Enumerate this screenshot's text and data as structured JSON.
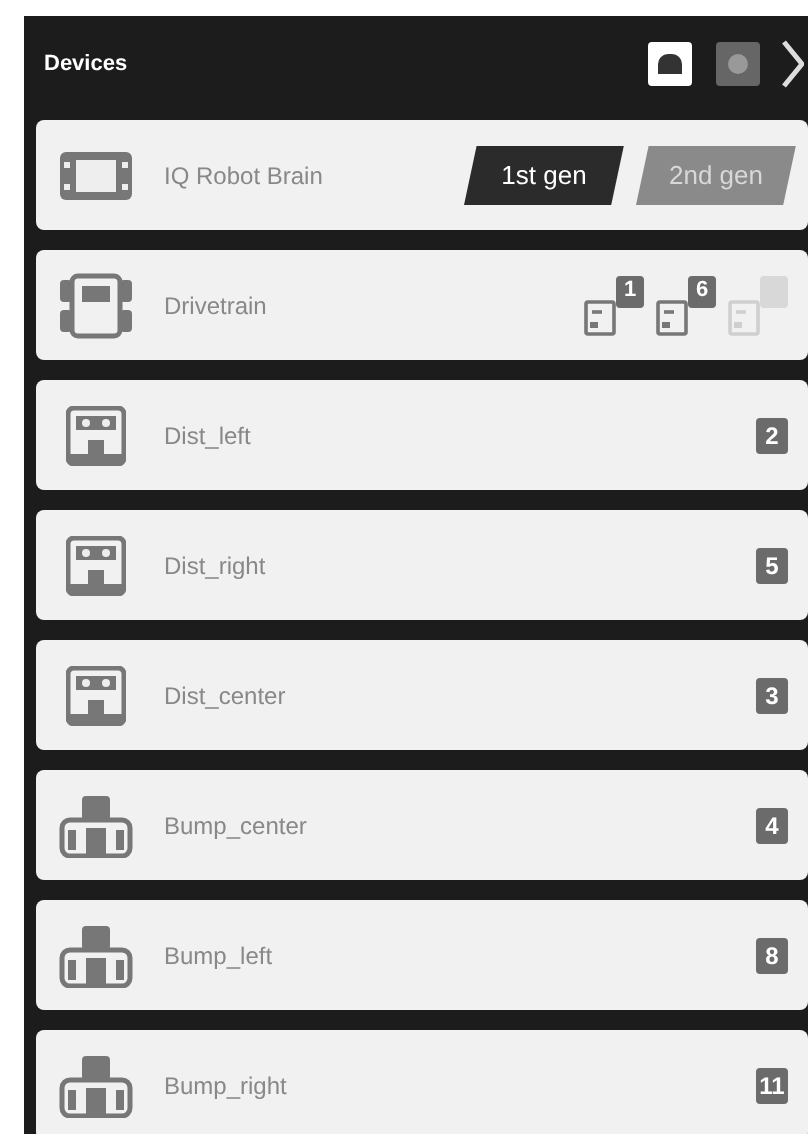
{
  "header": {
    "title": "Devices"
  },
  "devices": [
    {
      "kind": "brain",
      "name": "IQ Robot Brain",
      "gens": [
        {
          "label": "1st gen",
          "selected": true
        },
        {
          "label": "2nd gen",
          "selected": false
        }
      ]
    },
    {
      "kind": "drivetrain",
      "name": "Drivetrain",
      "ports": [
        {
          "label": "1",
          "disabled": false
        },
        {
          "label": "6",
          "disabled": false
        },
        {
          "disabled": true
        }
      ]
    },
    {
      "kind": "distance",
      "name": "Dist_left",
      "port": "2"
    },
    {
      "kind": "distance",
      "name": "Dist_right",
      "port": "5"
    },
    {
      "kind": "distance",
      "name": "Dist_center",
      "port": "3"
    },
    {
      "kind": "bumper",
      "name": "Bump_center",
      "port": "4"
    },
    {
      "kind": "bumper",
      "name": "Bump_left",
      "port": "8"
    },
    {
      "kind": "bumper",
      "name": "Bump_right",
      "port": "11"
    }
  ]
}
